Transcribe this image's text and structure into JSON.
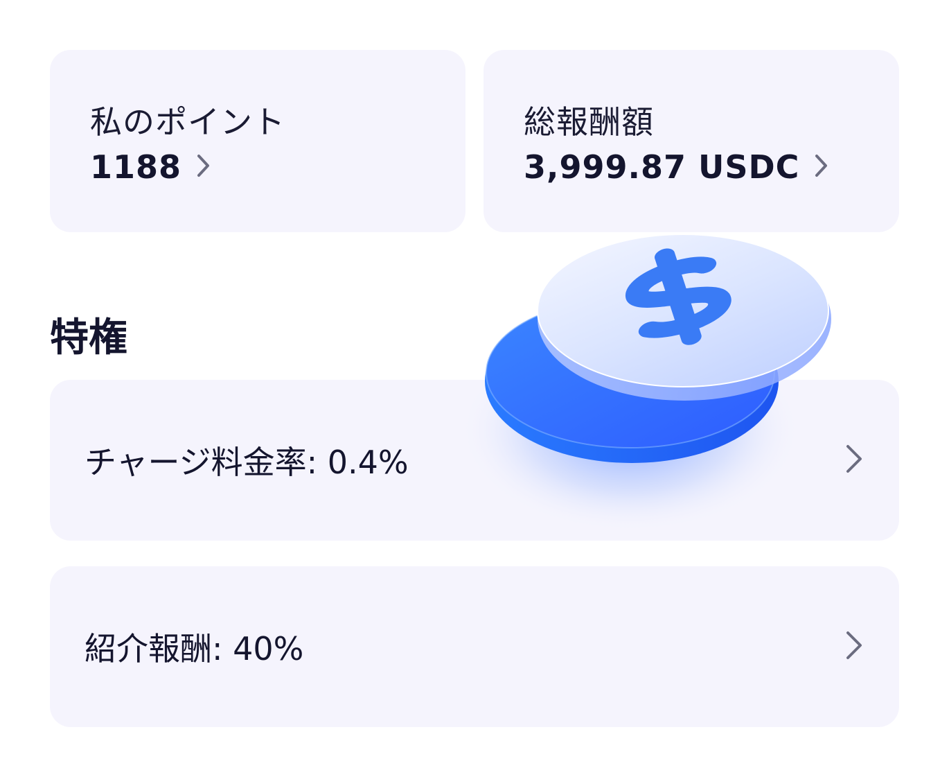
{
  "points_card": {
    "label": "私のポイント",
    "value": "1188"
  },
  "rewards_card": {
    "label": "総報酬額",
    "value": "3,999.87 USDC"
  },
  "privileges": {
    "title": "特権",
    "items": [
      {
        "label": "チャージ料金率: 0.4%"
      },
      {
        "label": "紹介報酬: 40%"
      }
    ]
  },
  "colors": {
    "card_bg": "#f5f4fd",
    "text": "#14152e",
    "accent_blue": "#2f6bff",
    "chevron": "#6b6c80"
  },
  "icons": {
    "chevron": "chevron-right-icon",
    "illustration": "dollar-coin-icon"
  }
}
